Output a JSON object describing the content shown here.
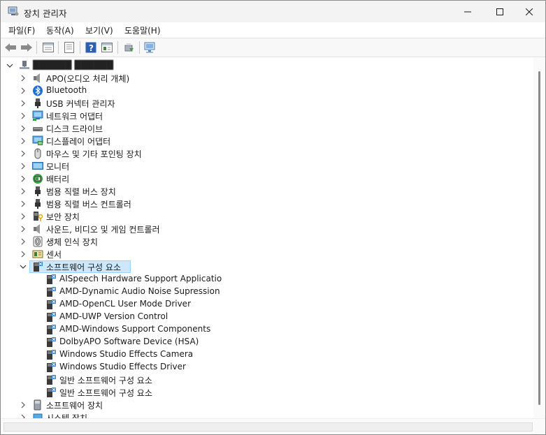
{
  "window": {
    "title": "장치 관리자",
    "app_icon": "device-manager-icon",
    "controls": [
      "minimize-icon",
      "maximize-icon",
      "close-icon"
    ]
  },
  "menu": {
    "file": "파일(F)",
    "action": "동작(A)",
    "view": "보기(V)",
    "help": "도움말(H)"
  },
  "toolbar": {
    "buttons": [
      "back-icon",
      "forward-icon",
      "properties-pane-icon",
      "list-view-icon",
      "help-icon",
      "show-view-icon",
      "update-driver-icon",
      "scan-hardware-icon"
    ]
  },
  "tree": {
    "root": {
      "label": "██████ ██████",
      "icon": "computer-icon",
      "expanded": true
    },
    "categories": [
      {
        "label": "APO(오디오 처리 개체)",
        "icon": "speaker-icon"
      },
      {
        "label": "Bluetooth",
        "icon": "bluetooth-icon"
      },
      {
        "label": "USB 커넥터 관리자",
        "icon": "usb-icon"
      },
      {
        "label": "네트워크 어댑터",
        "icon": "network-adapter-icon"
      },
      {
        "label": "디스크 드라이브",
        "icon": "disk-drive-icon"
      },
      {
        "label": "디스플레이 어댑터",
        "icon": "display-adapter-icon"
      },
      {
        "label": "마우스 및 기타 포인팅 장치",
        "icon": "mouse-icon"
      },
      {
        "label": "모니터",
        "icon": "monitor-icon"
      },
      {
        "label": "배터리",
        "icon": "battery-icon"
      },
      {
        "label": "범용 직렬 버스 장치",
        "icon": "usb-device-icon"
      },
      {
        "label": "범용 직렬 버스 컨트롤러",
        "icon": "usb-controller-icon"
      },
      {
        "label": "보안 장치",
        "icon": "security-device-icon"
      },
      {
        "label": "사운드, 비디오 및 게임 컨트롤러",
        "icon": "sound-icon"
      },
      {
        "label": "생체 인식 장치",
        "icon": "fingerprint-icon"
      },
      {
        "label": "센서",
        "icon": "sensor-icon"
      },
      {
        "label": "소프트웨어 구성 요소",
        "icon": "software-component-icon",
        "expanded": true,
        "selected": true
      }
    ],
    "children": [
      {
        "label": "AISpeech Hardware Support Applicatio",
        "icon": "software-component-icon"
      },
      {
        "label": "AMD-Dynamic Audio Noise Supression",
        "icon": "software-component-icon"
      },
      {
        "label": "AMD-OpenCL User Mode Driver",
        "icon": "software-component-icon"
      },
      {
        "label": "AMD-UWP Version Control",
        "icon": "software-component-icon"
      },
      {
        "label": "AMD-Windows Support Components",
        "icon": "software-component-icon"
      },
      {
        "label": "DolbyAPO Software Device (HSA)",
        "icon": "software-component-icon"
      },
      {
        "label": "Windows Studio Effects Camera",
        "icon": "software-component-icon"
      },
      {
        "label": "Windows Studio Effects Driver",
        "icon": "software-component-icon"
      },
      {
        "label": "일반 소프트웨어 구성 요소",
        "icon": "software-component-icon"
      },
      {
        "label": "일반 소프트웨어 구성 요소",
        "icon": "software-component-icon"
      }
    ],
    "after": [
      {
        "label": "소프트웨어 장치",
        "icon": "software-device-icon"
      },
      {
        "label": "시스템 장치",
        "icon": "system-device-icon"
      }
    ]
  },
  "colors": {
    "selection_bg": "#cce8ff",
    "selection_border": "#99d1ff",
    "titlebar_bg": "#f3f3f3"
  }
}
